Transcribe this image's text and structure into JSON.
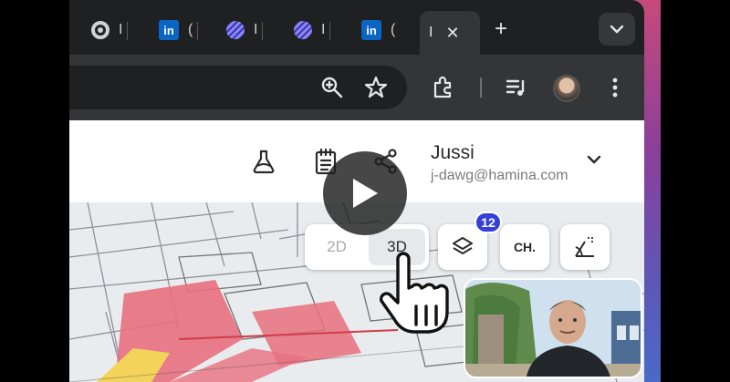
{
  "browser": {
    "tabs": [
      {
        "icon": "chrome-icon",
        "label": "I"
      },
      {
        "icon": "linkedin-icon",
        "glyph": "in",
        "label": "("
      },
      {
        "icon": "hamina-icon",
        "label": "I"
      },
      {
        "icon": "hamina-icon",
        "label": "I"
      },
      {
        "icon": "linkedin-icon",
        "glyph": "in",
        "label": "("
      }
    ],
    "active_tab": {
      "label": "I",
      "close": "✕"
    },
    "new_tab": "+"
  },
  "header": {
    "user_name": "Jussi",
    "user_email": "j-dawg@hamina.com"
  },
  "map_controls": {
    "view_2d": "2D",
    "view_3d": "3D",
    "active_view": "3D",
    "layers_badge": "12",
    "channel_label": "CH."
  },
  "colors": {
    "accent": "#3540d6",
    "tabbar": "#1f2021",
    "toolbar": "#333537",
    "floor_red": "#e8707e",
    "floor_yellow": "#f3d35a"
  }
}
